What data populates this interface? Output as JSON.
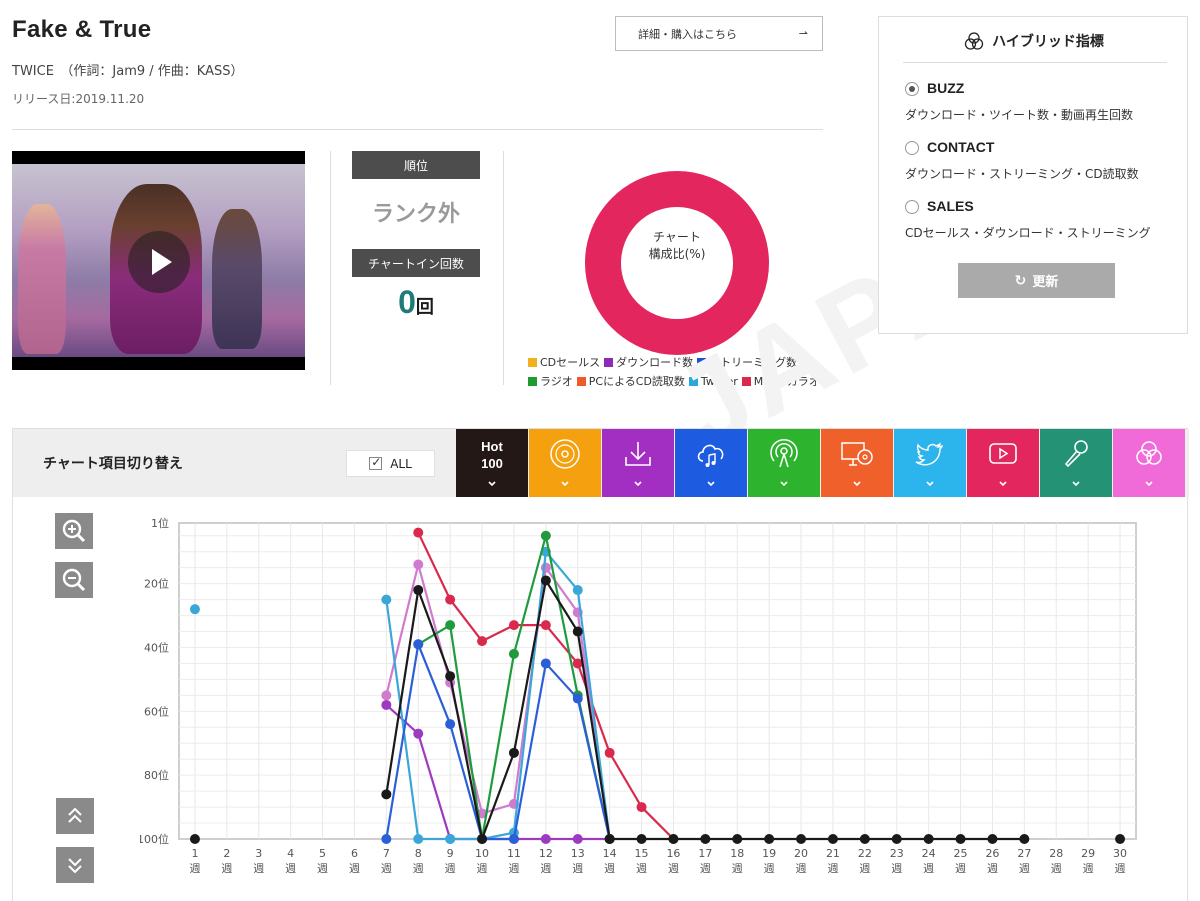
{
  "song": {
    "title": "Fake & True",
    "artist_line": "TWICE　（作詞：Jam9 / 作曲：KASS）",
    "release_line": "リリース日:2019.11.20",
    "detail_button": "詳細・購入はこちら"
  },
  "rank": {
    "rank_label": "順位",
    "rank_value": "ランク外",
    "chartin_label": "チャートイン回数",
    "chartin_value": "0",
    "chartin_unit": "回"
  },
  "composition": {
    "label_line1": "チャート",
    "label_line2": "構成比(%)",
    "donut_color": "#e3265d",
    "legend": [
      {
        "label": "CDセールス",
        "color": "#f2b01e"
      },
      {
        "label": "ダウンロード数",
        "color": "#8e2ab5"
      },
      {
        "label": "ストリーミング数",
        "color": "#1f4fd6"
      },
      {
        "label": "ラジオ",
        "color": "#1f9b2d"
      },
      {
        "label": "PCによるCD読取数",
        "color": "#ee5a2a"
      },
      {
        "label": "Twitter",
        "color": "#2aa6e0"
      },
      {
        "label": "MV",
        "color": "#d92a4e"
      },
      {
        "label": "カラオケ",
        "color": "#24907a"
      }
    ]
  },
  "hybrid": {
    "title": "ハイブリッド指標",
    "options": [
      {
        "label": "BUZZ",
        "desc": "ダウンロード・ツイート数・動画再生回数",
        "selected": true
      },
      {
        "label": "CONTACT",
        "desc": "ダウンロード・ストリーミング・CD読取数",
        "selected": false
      },
      {
        "label": "SALES",
        "desc": "CDセールス・ダウンロード・ストリーミング",
        "selected": false
      }
    ],
    "refresh_label": "更新"
  },
  "toolbar": {
    "label": "チャート項目切り替え",
    "all_label": "ALL",
    "hot_label_1": "Hot",
    "hot_label_2": "100",
    "tabs": [
      {
        "name": "hot100",
        "color": "#231815"
      },
      {
        "name": "cd-sales",
        "color": "#f5a00f"
      },
      {
        "name": "download",
        "color": "#a22fc1"
      },
      {
        "name": "streaming",
        "color": "#1d5be0"
      },
      {
        "name": "radio",
        "color": "#2eb32e"
      },
      {
        "name": "pc-cd-read",
        "color": "#f0602a"
      },
      {
        "name": "twitter",
        "color": "#2cb4ec"
      },
      {
        "name": "mv",
        "color": "#e3265d"
      },
      {
        "name": "karaoke",
        "color": "#239275"
      },
      {
        "name": "hybrid",
        "color": "#f06ad8"
      }
    ]
  },
  "watermark": "JAPAN",
  "chart_data": {
    "type": "line",
    "x": [
      "1週",
      "2週",
      "3週",
      "4週",
      "5週",
      "6週",
      "7週",
      "8週",
      "9週",
      "10週",
      "11週",
      "12週",
      "13週",
      "14週",
      "15週",
      "16週",
      "17週",
      "18週",
      "19週",
      "20週",
      "21週",
      "22週",
      "23週",
      "24週",
      "25週",
      "26週",
      "27週",
      "28週",
      "29週",
      "30週"
    ],
    "x_numbers": [
      "1",
      "2",
      "3",
      "4",
      "5",
      "6",
      "7",
      "8",
      "9",
      "10",
      "11",
      "12",
      "13",
      "14",
      "15",
      "16",
      "17",
      "18",
      "19",
      "20",
      "21",
      "22",
      "23",
      "24",
      "25",
      "26",
      "27",
      "28",
      "29",
      "30"
    ],
    "x_unit": "週",
    "y_ticks": [
      "1位",
      "20位",
      "40位",
      "60位",
      "80位",
      "100位"
    ],
    "y_tick_values": [
      1,
      20,
      40,
      60,
      80,
      100
    ],
    "ylim": [
      1,
      100
    ],
    "y_reversed": true,
    "grid": true,
    "series": [
      {
        "key": "mv",
        "color": "#d92a4e",
        "points": [
          [
            8,
            4
          ],
          [
            9,
            25
          ],
          [
            10,
            38
          ],
          [
            11,
            33
          ],
          [
            12,
            33
          ],
          [
            13,
            45
          ],
          [
            14,
            73
          ],
          [
            15,
            90
          ],
          [
            16,
            100
          ]
        ]
      },
      {
        "key": "hybrid",
        "color": "#d07ad0",
        "points": [
          [
            7,
            55
          ],
          [
            8,
            14
          ],
          [
            9,
            51
          ],
          [
            10,
            92
          ],
          [
            11,
            89
          ],
          [
            12,
            15
          ],
          [
            13,
            29
          ],
          [
            14,
            100
          ]
        ]
      },
      {
        "key": "download",
        "color": "#9d3bbf",
        "points": [
          [
            7,
            58
          ],
          [
            8,
            67
          ],
          [
            9,
            100
          ],
          [
            10,
            100
          ],
          [
            11,
            100
          ],
          [
            12,
            100
          ],
          [
            13,
            100
          ],
          [
            14,
            100
          ]
        ]
      },
      {
        "key": "twitter",
        "color": "#3aa7d8",
        "points": [
          [
            1,
            28
          ],
          [
            7,
            25
          ],
          [
            8,
            100
          ],
          [
            9,
            100
          ],
          [
            10,
            100
          ],
          [
            11,
            98
          ],
          [
            12,
            10
          ],
          [
            13,
            22
          ],
          [
            14,
            100
          ]
        ]
      },
      {
        "key": "radio",
        "color": "#1f9b3d",
        "points": [
          [
            8,
            39
          ],
          [
            9,
            33
          ],
          [
            10,
            100
          ],
          [
            11,
            42
          ],
          [
            12,
            5
          ],
          [
            13,
            55
          ],
          [
            14,
            100
          ]
        ]
      },
      {
        "key": "streaming",
        "color": "#2b5fd8",
        "points": [
          [
            7,
            100
          ],
          [
            8,
            39
          ],
          [
            9,
            64
          ],
          [
            10,
            100
          ],
          [
            11,
            100
          ],
          [
            12,
            45
          ],
          [
            13,
            56
          ],
          [
            14,
            100
          ]
        ]
      },
      {
        "key": "hot100",
        "color": "#1a1a1a",
        "points": [
          [
            1,
            100
          ],
          [
            7,
            86
          ],
          [
            8,
            22
          ],
          [
            9,
            49
          ],
          [
            10,
            100
          ],
          [
            11,
            73
          ],
          [
            12,
            19
          ],
          [
            13,
            35
          ],
          [
            14,
            100
          ],
          [
            15,
            100
          ],
          [
            16,
            100
          ],
          [
            17,
            100
          ],
          [
            18,
            100
          ],
          [
            19,
            100
          ],
          [
            20,
            100
          ],
          [
            21,
            100
          ],
          [
            22,
            100
          ],
          [
            23,
            100
          ],
          [
            24,
            100
          ],
          [
            25,
            100
          ],
          [
            26,
            100
          ],
          [
            27,
            100
          ],
          [
            30,
            100
          ]
        ]
      }
    ]
  }
}
